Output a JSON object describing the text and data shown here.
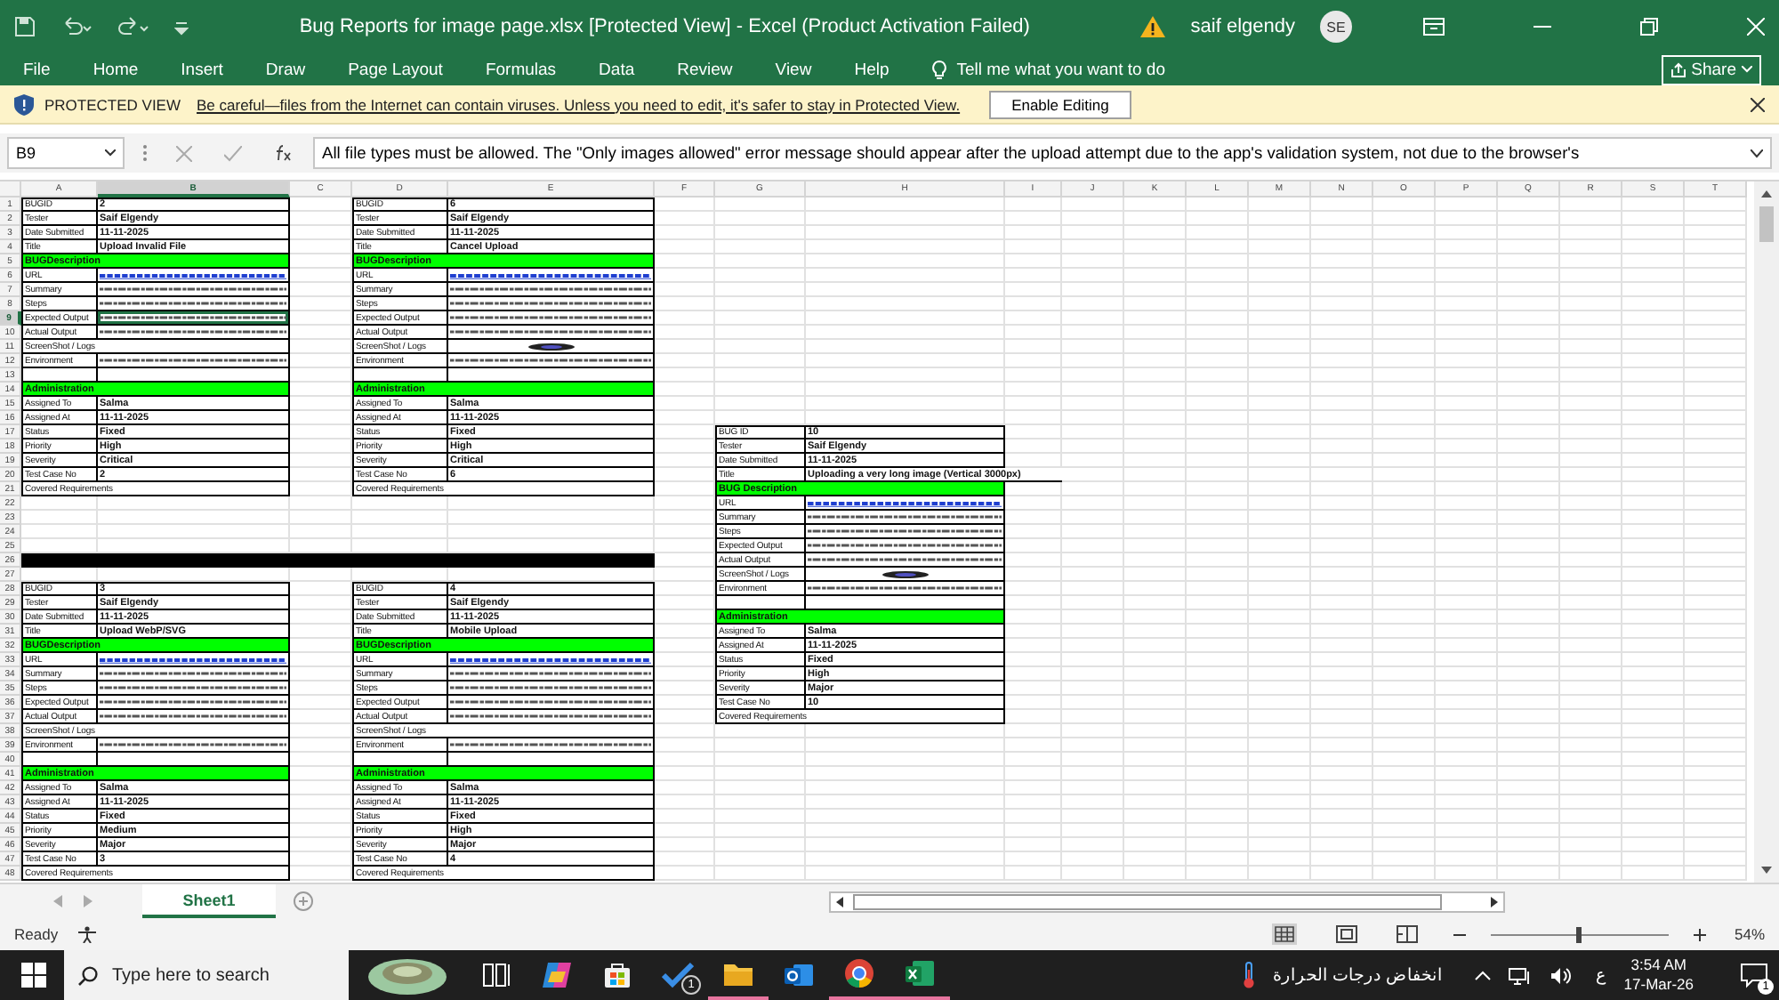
{
  "title_bar": {
    "title": "Bug Reports for image page.xlsx  [Protected View]  -  Excel (Product Activation Failed)",
    "user": "saif elgendy",
    "avatar_initials": "SE"
  },
  "menu": {
    "tabs": [
      "File",
      "Home",
      "Insert",
      "Draw",
      "Page Layout",
      "Formulas",
      "Data",
      "Review",
      "View",
      "Help"
    ],
    "tell_me": "Tell me what you want to do",
    "share": "Share"
  },
  "protected_view": {
    "label": "PROTECTED VIEW",
    "message": "Be careful—files from the Internet can contain viruses. Unless you need to edit, it's safer to stay in Protected View.",
    "button": "Enable Editing"
  },
  "formula_bar": {
    "name_box": "B9",
    "formula": "All file types must be allowed. The \"Only images allowed\" error message should appear after the upload attempt due to the app's validation system, not due to the browser's"
  },
  "sheet": {
    "columns": [
      {
        "label": "A",
        "selected": false
      },
      {
        "label": "B",
        "selected": true
      },
      {
        "label": "C",
        "selected": false
      },
      {
        "label": "D",
        "selected": false
      },
      {
        "label": "E",
        "selected": false
      },
      {
        "label": "F",
        "selected": false
      },
      {
        "label": "G",
        "selected": false
      },
      {
        "label": "H",
        "selected": false
      },
      {
        "label": "I",
        "selected": false
      },
      {
        "label": "J",
        "selected": false
      },
      {
        "label": "K",
        "selected": false
      },
      {
        "label": "L",
        "selected": false
      },
      {
        "label": "M",
        "selected": false
      },
      {
        "label": "N",
        "selected": false
      },
      {
        "label": "O",
        "selected": false
      },
      {
        "label": "P",
        "selected": false
      },
      {
        "label": "Q",
        "selected": false
      },
      {
        "label": "R",
        "selected": false
      },
      {
        "label": "S",
        "selected": false
      },
      {
        "label": "T",
        "selected": false
      }
    ],
    "rows": [
      {
        "label": "1",
        "selected": false
      },
      {
        "label": "2",
        "selected": false
      },
      {
        "label": "3",
        "selected": false
      },
      {
        "label": "4",
        "selected": false
      },
      {
        "label": "5",
        "selected": false
      },
      {
        "label": "6",
        "selected": false
      },
      {
        "label": "7",
        "selected": false
      },
      {
        "label": "8",
        "selected": false
      },
      {
        "label": "9",
        "selected": true
      },
      {
        "label": "10",
        "selected": false
      },
      {
        "label": "11",
        "selected": false
      },
      {
        "label": "12",
        "selected": false
      },
      {
        "label": "13",
        "selected": false
      },
      {
        "label": "14",
        "selected": false
      },
      {
        "label": "15",
        "selected": false
      },
      {
        "label": "16",
        "selected": false
      },
      {
        "label": "17",
        "selected": false
      },
      {
        "label": "18",
        "selected": false
      },
      {
        "label": "19",
        "selected": false
      },
      {
        "label": "20",
        "selected": false
      },
      {
        "label": "21",
        "selected": false
      },
      {
        "label": "22",
        "selected": false
      },
      {
        "label": "23",
        "selected": false
      },
      {
        "label": "24",
        "selected": false
      },
      {
        "label": "25",
        "selected": false
      },
      {
        "label": "26",
        "selected": false
      },
      {
        "label": "27",
        "selected": false
      },
      {
        "label": "28",
        "selected": false
      },
      {
        "label": "29",
        "selected": false
      },
      {
        "label": "30",
        "selected": false
      },
      {
        "label": "31",
        "selected": false
      },
      {
        "label": "32",
        "selected": false
      },
      {
        "label": "33",
        "selected": false
      },
      {
        "label": "34",
        "selected": false
      },
      {
        "label": "35",
        "selected": false
      },
      {
        "label": "36",
        "selected": false
      },
      {
        "label": "37",
        "selected": false
      },
      {
        "label": "38",
        "selected": false
      },
      {
        "label": "39",
        "selected": false
      },
      {
        "label": "40",
        "selected": false
      },
      {
        "label": "41",
        "selected": false
      },
      {
        "label": "42",
        "selected": false
      },
      {
        "label": "43",
        "selected": false
      },
      {
        "label": "44",
        "selected": false
      },
      {
        "label": "45",
        "selected": false
      },
      {
        "label": "46",
        "selected": false
      },
      {
        "label": "47",
        "selected": false
      },
      {
        "label": "48",
        "selected": false
      }
    ],
    "reports": [
      {
        "fields": [
          {
            "kind": "field",
            "label": "BUGID",
            "value": "2"
          },
          {
            "kind": "field",
            "label": "Tester",
            "value": "Saif Elgendy"
          },
          {
            "kind": "field",
            "label": "Date Submitted",
            "value": "11-11-2025"
          },
          {
            "kind": "field",
            "label": "Title",
            "value": "Upload Invalid File"
          },
          {
            "kind": "section",
            "label": "BUGDescription"
          },
          {
            "kind": "link",
            "label": "URL"
          },
          {
            "kind": "scribble",
            "label": "Summary"
          },
          {
            "kind": "scribble",
            "label": "Steps"
          },
          {
            "kind": "scribble",
            "label": "Expected Output"
          },
          {
            "kind": "scribble",
            "label": "Actual Output"
          },
          {
            "kind": "field",
            "label": "ScreenShot / Logs"
          },
          {
            "kind": "scribble",
            "label": "Environment"
          },
          {
            "kind": "blank"
          },
          {
            "kind": "section",
            "label": "Administration"
          },
          {
            "kind": "field",
            "label": "Assigned To",
            "value": "Salma"
          },
          {
            "kind": "field",
            "label": "Assigned At",
            "value": "11-11-2025"
          },
          {
            "kind": "field",
            "label": "Status",
            "value": "Fixed"
          },
          {
            "kind": "field",
            "label": "Priority",
            "value": "High"
          },
          {
            "kind": "field",
            "label": "Severity",
            "value": "Critical"
          },
          {
            "kind": "field",
            "label": "Test Case No",
            "value": "2"
          },
          {
            "kind": "field",
            "label": "Covered Requirements"
          }
        ]
      },
      {
        "fields": [
          {
            "kind": "field",
            "label": "BUGID",
            "value": "6"
          },
          {
            "kind": "field",
            "label": "Tester",
            "value": "Saif Elgendy"
          },
          {
            "kind": "field",
            "label": "Date Submitted",
            "value": "11-11-2025"
          },
          {
            "kind": "field",
            "label": "Title",
            "value": "Cancel Upload"
          },
          {
            "kind": "section",
            "label": "BUGDescription"
          },
          {
            "kind": "link",
            "label": "URL"
          },
          {
            "kind": "scribble",
            "label": "Summary"
          },
          {
            "kind": "scribble",
            "label": "Steps"
          },
          {
            "kind": "scribble",
            "label": "Expected Output"
          },
          {
            "kind": "scribble",
            "label": "Actual Output"
          },
          {
            "kind": "image",
            "label": "ScreenShot / Logs"
          },
          {
            "kind": "scribble",
            "label": "Environment"
          },
          {
            "kind": "blank"
          },
          {
            "kind": "section",
            "label": "Administration"
          },
          {
            "kind": "field",
            "label": "Assigned To",
            "value": "Salma"
          },
          {
            "kind": "field",
            "label": "Assigned At",
            "value": "11-11-2025"
          },
          {
            "kind": "field",
            "label": "Status",
            "value": "Fixed"
          },
          {
            "kind": "field",
            "label": "Priority",
            "value": "High"
          },
          {
            "kind": "field",
            "label": "Severity",
            "value": "Critical"
          },
          {
            "kind": "field",
            "label": "Test Case No",
            "value": "6"
          },
          {
            "kind": "field",
            "label": "Covered Requirements"
          }
        ]
      },
      {
        "fields": [
          {
            "kind": "field",
            "label": "BUGID",
            "value": "3"
          },
          {
            "kind": "field",
            "label": "Tester",
            "value": "Saif Elgendy"
          },
          {
            "kind": "field",
            "label": "Date Submitted",
            "value": "11-11-2025"
          },
          {
            "kind": "field",
            "label": "Title",
            "value": "Upload WebP/SVG"
          },
          {
            "kind": "section",
            "label": "BUGDescription"
          },
          {
            "kind": "link",
            "label": "URL"
          },
          {
            "kind": "scribble",
            "label": "Summary"
          },
          {
            "kind": "scribble",
            "label": "Steps"
          },
          {
            "kind": "scribble",
            "label": "Expected Output"
          },
          {
            "kind": "scribble",
            "label": "Actual Output"
          },
          {
            "kind": "field",
            "label": "ScreenShot / Logs"
          },
          {
            "kind": "scribble",
            "label": "Environment"
          },
          {
            "kind": "blank"
          },
          {
            "kind": "section",
            "label": "Administration"
          },
          {
            "kind": "field",
            "label": "Assigned To",
            "value": "Salma"
          },
          {
            "kind": "field",
            "label": "Assigned At",
            "value": "11-11-2025"
          },
          {
            "kind": "field",
            "label": "Status",
            "value": "Fixed"
          },
          {
            "kind": "field",
            "label": "Priority",
            "value": "Medium"
          },
          {
            "kind": "field",
            "label": "Severity",
            "value": "Major"
          },
          {
            "kind": "field",
            "label": "Test Case No",
            "value": "3"
          },
          {
            "kind": "field",
            "label": "Covered Requirements"
          }
        ]
      },
      {
        "fields": [
          {
            "kind": "field",
            "label": "BUGID",
            "value": "4"
          },
          {
            "kind": "field",
            "label": "Tester",
            "value": "Saif Elgendy"
          },
          {
            "kind": "field",
            "label": "Date Submitted",
            "value": "11-11-2025"
          },
          {
            "kind": "field",
            "label": "Title",
            "value": "Mobile Upload"
          },
          {
            "kind": "section",
            "label": "BUGDescription"
          },
          {
            "kind": "link",
            "label": "URL"
          },
          {
            "kind": "scribble",
            "label": "Summary"
          },
          {
            "kind": "scribble",
            "label": "Steps"
          },
          {
            "kind": "scribble",
            "label": "Expected Output"
          },
          {
            "kind": "scribble",
            "label": "Actual Output"
          },
          {
            "kind": "field",
            "label": "ScreenShot / Logs"
          },
          {
            "kind": "scribble",
            "label": "Environment"
          },
          {
            "kind": "blank"
          },
          {
            "kind": "section",
            "label": "Administration"
          },
          {
            "kind": "field",
            "label": "Assigned To",
            "value": "Salma"
          },
          {
            "kind": "field",
            "label": "Assigned At",
            "value": "11-11-2025"
          },
          {
            "kind": "field",
            "label": "Status",
            "value": "Fixed"
          },
          {
            "kind": "field",
            "label": "Priority",
            "value": "High"
          },
          {
            "kind": "field",
            "label": "Severity",
            "value": "Major"
          },
          {
            "kind": "field",
            "label": "Test Case No",
            "value": "4"
          },
          {
            "kind": "field",
            "label": "Covered Requirements"
          }
        ]
      },
      {
        "fields": [
          {
            "kind": "field",
            "label": "BUG ID",
            "value": "10"
          },
          {
            "kind": "field",
            "label": "Tester",
            "value": "Saif Elgendy"
          },
          {
            "kind": "field",
            "label": "Date Submitted",
            "value": "11-11-2025"
          },
          {
            "kind": "field",
            "label": "Title",
            "value": "Uploading a very long image (Vertical 3000px)"
          },
          {
            "kind": "section",
            "label": "BUG Description"
          },
          {
            "kind": "link",
            "label": "URL"
          },
          {
            "kind": "scribble",
            "label": "Summary"
          },
          {
            "kind": "scribble",
            "label": "Steps"
          },
          {
            "kind": "scribble",
            "label": "Expected Output"
          },
          {
            "kind": "scribble",
            "label": "Actual Output"
          },
          {
            "kind": "image",
            "label": "ScreenShot / Logs"
          },
          {
            "kind": "scribble",
            "label": "Environment"
          },
          {
            "kind": "blank"
          },
          {
            "kind": "section",
            "label": "Administration"
          },
          {
            "kind": "field",
            "label": "Assigned To",
            "value": "Salma"
          },
          {
            "kind": "field",
            "label": "Assigned At",
            "value": "11-11-2025"
          },
          {
            "kind": "field",
            "label": "Status",
            "value": "Fixed"
          },
          {
            "kind": "field",
            "label": "Priority",
            "value": "High"
          },
          {
            "kind": "field",
            "label": "Severity",
            "value": "Major"
          },
          {
            "kind": "field",
            "label": "Test Case No",
            "value": "10"
          },
          {
            "kind": "field",
            "label": "Covered Requirements"
          }
        ]
      }
    ]
  },
  "sheet_tabs": [
    {
      "label": "Sheet1",
      "selected": true
    }
  ],
  "status_bar": {
    "status": "Ready",
    "zoom": "54%",
    "zoom_slider": {
      "level": 0.5
    }
  },
  "taskbar": {
    "search_placeholder": "Type here to search",
    "apps": [
      {
        "kind": "task-view",
        "running": false
      },
      {
        "kind": "copilot",
        "running": false
      },
      {
        "kind": "store",
        "running": false
      },
      {
        "kind": "todo",
        "running": false,
        "badge": "1"
      },
      {
        "kind": "explorer",
        "running": true
      },
      {
        "kind": "outlook",
        "running": false
      },
      {
        "kind": "chrome",
        "running": true
      },
      {
        "kind": "excel",
        "running": true
      }
    ],
    "weather": "انخفاض درجات الحرارة",
    "input_language": "ع",
    "time": "3:54 AM",
    "date": "17-Mar-26",
    "notification_count": "1"
  }
}
